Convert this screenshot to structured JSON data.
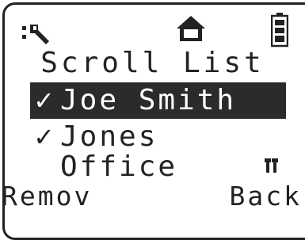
{
  "status_bar": {
    "left_icon": "wrench-icon",
    "center_icon": "home-icon",
    "right_icon": "battery-icon"
  },
  "title": "Scroll List",
  "list": [
    {
      "label": "Joe Smith",
      "checked": true,
      "selected": true,
      "icon": "check-icon"
    },
    {
      "label": "Jones",
      "checked": true,
      "selected": false,
      "icon": "check-icon"
    },
    {
      "label": "Office",
      "checked": false,
      "selected": false,
      "right_icon": "signal-icon"
    }
  ],
  "softkeys": {
    "left": "Remov",
    "right": "Back"
  },
  "colors": {
    "foreground": "#222222",
    "selection_background": "#2b2b2b",
    "background": "#ffffff"
  }
}
